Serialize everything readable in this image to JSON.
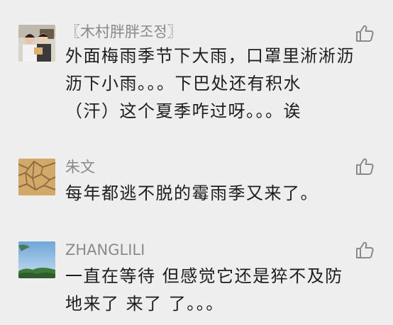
{
  "comments": [
    {
      "author": "〖木村胖胖조정〗",
      "lines": [
        "外面梅雨季节下大雨，口罩里淅淅沥",
        "沥下小雨。。。下巴处还有积水",
        "（汗）这个夏季咋过呀。。。诶"
      ],
      "avatar_icon": "two-people-photo-icon",
      "like_icon": "thumbs-up-icon"
    },
    {
      "author": "朱文",
      "lines": [
        "每年都逃不脱的霉雨季又来了。"
      ],
      "avatar_icon": "cracked-earth-photo-icon",
      "like_icon": "thumbs-up-icon"
    },
    {
      "author": "ZHANGLILI",
      "lines": [
        "一直在等待 但感觉它还是猝不及防",
        "地来了 来了 了。。。"
      ],
      "avatar_icon": "sky-landscape-photo-icon",
      "like_icon": "thumbs-up-icon"
    }
  ],
  "colors": {
    "background": "#eeeeee",
    "author_text": "#8a8a8a",
    "body_text": "#1d1d1d",
    "like_icon": "#8a8a8a"
  }
}
